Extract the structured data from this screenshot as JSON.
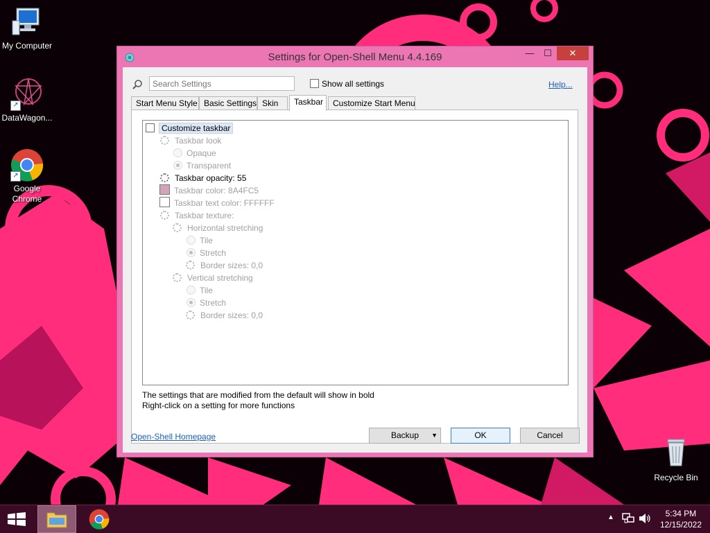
{
  "desktop": {
    "icons": [
      {
        "label": "My Computer"
      },
      {
        "label": "DataWagon..."
      },
      {
        "label": "Google Chrome"
      },
      {
        "label": "Recycle Bin"
      }
    ]
  },
  "window": {
    "title": "Settings for Open-Shell Menu 4.4.169",
    "controls": {
      "minimize": "—",
      "maximize": "☐",
      "close": "✕"
    },
    "search": {
      "placeholder": "Search Settings",
      "value": ""
    },
    "show_all_label": "Show all settings",
    "show_all_checked": false,
    "help_label": "Help...",
    "tabs": [
      {
        "label": "Start Menu Style",
        "active": false
      },
      {
        "label": "Basic Settings",
        "active": false
      },
      {
        "label": "Skin",
        "active": false
      },
      {
        "label": "Taskbar",
        "active": true
      },
      {
        "label": "Customize Start Menu",
        "active": false
      }
    ],
    "settings": [
      {
        "label": "Customize taskbar",
        "kind": "checkbox",
        "checked": false,
        "enabled": true,
        "bold": false
      },
      {
        "label": "Taskbar look",
        "kind": "gear",
        "enabled": false
      },
      {
        "label": "Opaque",
        "kind": "radio",
        "selected": false,
        "enabled": false
      },
      {
        "label": "Transparent",
        "kind": "radio",
        "selected": true,
        "enabled": false
      },
      {
        "label": "Taskbar opacity: 55",
        "kind": "gear",
        "enabled": true
      },
      {
        "label": "Taskbar color: 8A4FC5",
        "kind": "swatch",
        "color": "#d3a4b8",
        "enabled": false
      },
      {
        "label": "Taskbar text color: FFFFFF",
        "kind": "swatch",
        "color": "#ffffff",
        "enabled": false
      },
      {
        "label": "Taskbar texture:",
        "kind": "gear",
        "enabled": false
      },
      {
        "label": "Horizontal stretching",
        "kind": "gear",
        "enabled": false
      },
      {
        "label": "Tile",
        "kind": "radio",
        "selected": false,
        "enabled": false
      },
      {
        "label": "Stretch",
        "kind": "radio",
        "selected": true,
        "enabled": false
      },
      {
        "label": "Border sizes: 0,0",
        "kind": "gear",
        "enabled": false
      },
      {
        "label": "Vertical stretching",
        "kind": "gear",
        "enabled": false
      },
      {
        "label": "Tile",
        "kind": "radio",
        "selected": false,
        "enabled": false
      },
      {
        "label": "Stretch",
        "kind": "radio",
        "selected": true,
        "enabled": false
      },
      {
        "label": "Border sizes: 0,0",
        "kind": "gear",
        "enabled": false
      }
    ],
    "info_line1": "The settings that are modified from the default will show in bold",
    "info_line2": "Right-click on a setting for more functions",
    "homepage_label": "Open-Shell Homepage",
    "buttons": {
      "backup": "Backup",
      "ok": "OK",
      "cancel": "Cancel"
    }
  },
  "taskbar": {
    "time": "5:34 PM",
    "date": "12/15/2022"
  },
  "colors": {
    "window_frame": "#ec76b4",
    "close_button": "#c7413c",
    "wallpaper_accent": "#ff2d7c",
    "taskbar": "#3b0a24"
  }
}
